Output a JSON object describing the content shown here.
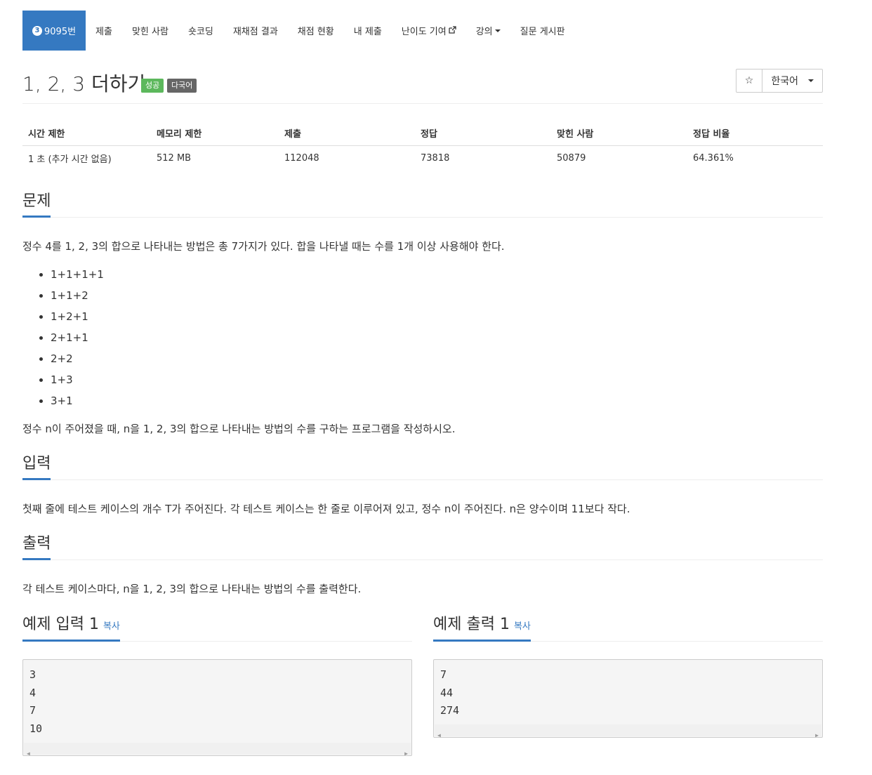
{
  "nav": {
    "items": [
      {
        "label": "9095번",
        "badge": "3",
        "active": true
      },
      {
        "label": "제출"
      },
      {
        "label": "맞힌 사람"
      },
      {
        "label": "숏코딩"
      },
      {
        "label": "재채점 결과"
      },
      {
        "label": "채점 현황"
      },
      {
        "label": "내 제출"
      },
      {
        "label": "난이도 기여",
        "icon": "external-link-icon"
      },
      {
        "label": "강의",
        "icon": "caret-down-icon"
      },
      {
        "label": "질문 게시판"
      }
    ]
  },
  "problem": {
    "title": "1, 2, 3 더하기",
    "labels": {
      "success": "성공",
      "multilang": "다국어"
    },
    "star_icon": "☆",
    "language": "한국어"
  },
  "info": {
    "headers": [
      "시간 제한",
      "메모리 제한",
      "제출",
      "정답",
      "맞힌 사람",
      "정답 비율"
    ],
    "values": [
      "1 초 (추가 시간 없음)",
      "512 MB",
      "112048",
      "73818",
      "50879",
      "64.361%"
    ]
  },
  "sections": {
    "problem": {
      "heading": "문제",
      "intro": "정수 4를 1, 2, 3의 합으로 나타내는 방법은 총 7가지가 있다. 합을 나타낼 때는 수를 1개 이상 사용해야 한다.",
      "items": [
        "1+1+1+1",
        "1+1+2",
        "1+2+1",
        "2+1+1",
        "2+2",
        "1+3",
        "3+1"
      ],
      "outro": "정수 n이 주어졌을 때, n을 1, 2, 3의 합으로 나타내는 방법의 수를 구하는 프로그램을 작성하시오."
    },
    "input": {
      "heading": "입력",
      "text": "첫째 줄에 테스트 케이스의 개수 T가 주어진다. 각 테스트 케이스는 한 줄로 이루어져 있고, 정수 n이 주어진다. n은 양수이며 11보다 작다."
    },
    "output": {
      "heading": "출력",
      "text": "각 테스트 케이스마다, n을 1, 2, 3의 합으로 나타내는 방법의 수를 출력한다."
    }
  },
  "samples": {
    "input": {
      "heading": "예제 입력 1",
      "copy": "복사",
      "content": "3\n4\n7\n10"
    },
    "output": {
      "heading": "예제 출력 1",
      "copy": "복사",
      "content": "7\n44\n274"
    }
  }
}
